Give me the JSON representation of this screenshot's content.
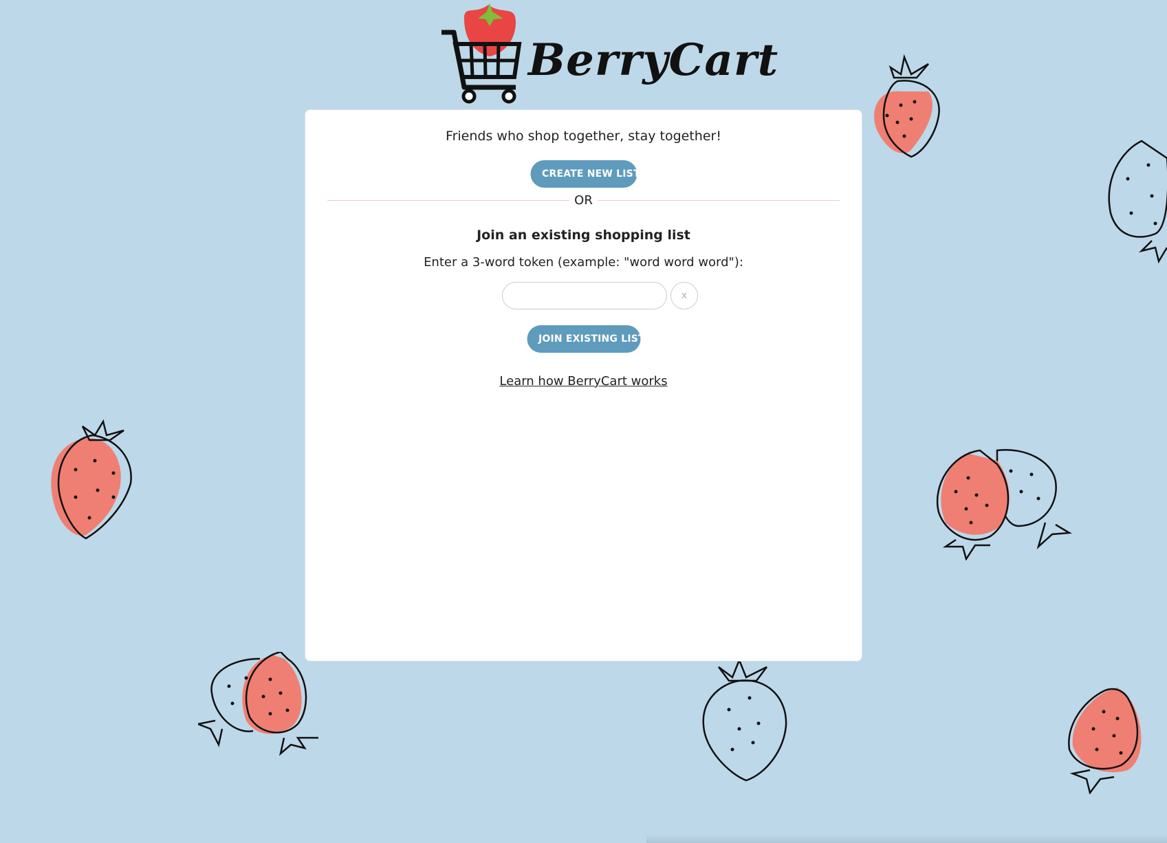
{
  "logo": {
    "brand_name": "BerryCart"
  },
  "card": {
    "tagline": "Friends who shop together, stay together!",
    "create_button": "CREATE NEW LIST",
    "divider_text": "OR",
    "join_heading": "Join an existing shopping list",
    "token_label": "Enter a 3-word token (example: \"word word word\"):",
    "token_input": {
      "value": "",
      "placeholder": ""
    },
    "clear_button": "x",
    "join_button": "JOIN EXISTING LIST",
    "learn_link": "Learn how BerryCart works"
  },
  "colors": {
    "background": "#bdd8e9",
    "button": "#5e9bbd",
    "strawberry": "#ef7f72",
    "divider": "#f0c7cb"
  },
  "icons": [
    "shopping-cart-icon",
    "strawberry-icon",
    "strawberry-doodle"
  ]
}
